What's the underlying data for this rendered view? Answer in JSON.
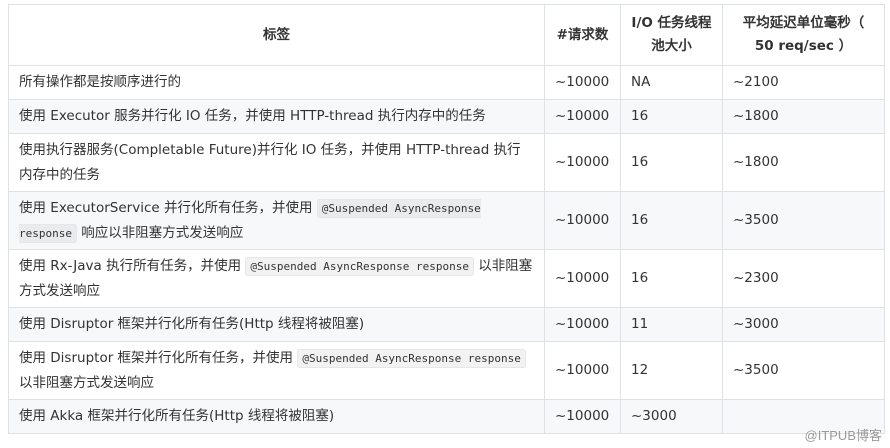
{
  "table": {
    "headers": [
      "标签",
      "#请求数",
      "I/O 任务线程池大小",
      "平均延迟单位毫秒（ 50 req/sec ）"
    ],
    "rows": [
      {
        "label": "所有操作都是按顺序进行的",
        "requests": "~10000",
        "pool": "NA",
        "latency": "~2100"
      },
      {
        "label": "使用 Executor 服务并行化 IO 任务，并使用 HTTP-thread 执行内存中的任务",
        "requests": "~10000",
        "pool": "16",
        "latency": "~1800"
      },
      {
        "label": "使用执行器服务(Completable Future)并行化 IO 任务，并使用 HTTP-thread 执行内存中的任务",
        "requests": "~10000",
        "pool": "16",
        "latency": "~1800"
      },
      {
        "label_pre": "使用 ExecutorService 并行化所有任务，并使用 ",
        "label_code": "@Suspended AsyncResponse response",
        "label_post": " 响应以非阻塞方式发送响应",
        "requests": "~10000",
        "pool": "16",
        "latency": "~3500"
      },
      {
        "label_pre": "使用 Rx-Java 执行所有任务，并使用 ",
        "label_code": "@Suspended AsyncResponse response",
        "label_post": " 以非阻塞方式发送响应",
        "requests": "~10000",
        "pool": "16",
        "latency": "~2300"
      },
      {
        "label": "使用 Disruptor 框架并行化所有任务(Http 线程将被阻塞)",
        "requests": "~10000",
        "pool": "11",
        "latency": "~3000"
      },
      {
        "label_pre": "使用 Disruptor 框架并行化所有任务，并使用 ",
        "label_code": "@Suspended AsyncResponse response",
        "label_post": " 以非阻塞方式发送响应",
        "requests": "~10000",
        "pool": "12",
        "latency": "~3500"
      },
      {
        "label": "使用 Akka 框架并行化所有任务(Http 线程将被阻塞)",
        "requests": "~10000",
        "pool": "~3000",
        "latency": ""
      }
    ]
  },
  "watermark": "@ITPUB博客"
}
